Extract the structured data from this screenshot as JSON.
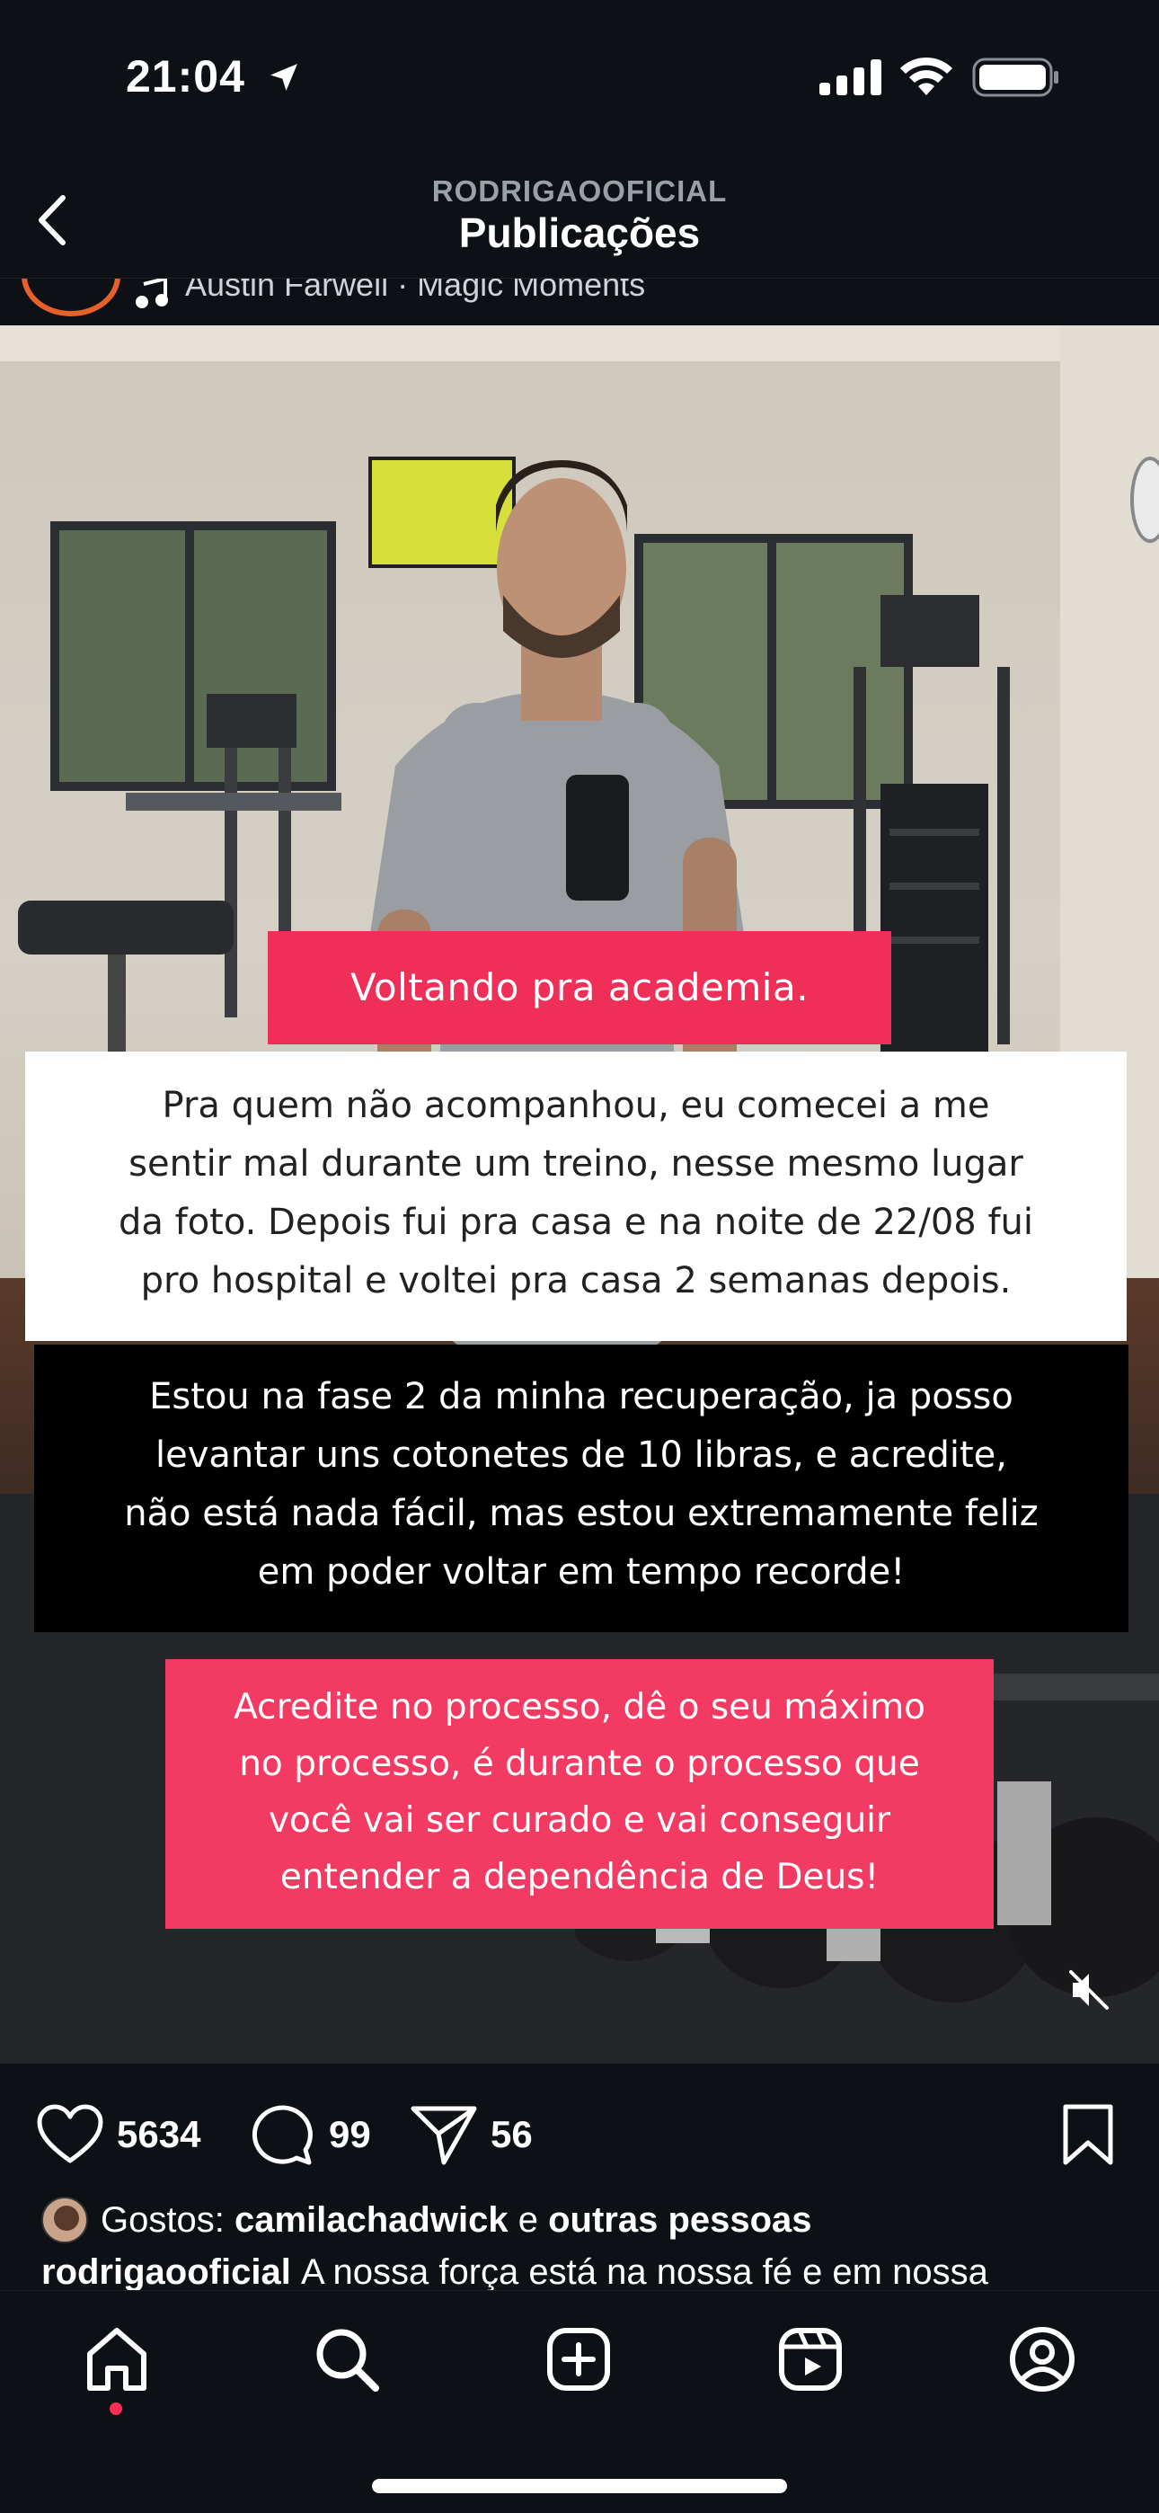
{
  "status_bar": {
    "time": "21:04",
    "icons": [
      "location-arrow-icon",
      "cellular-signal-icon",
      "wifi-icon",
      "battery-icon"
    ]
  },
  "header": {
    "username": "RODRIGAOOFICIAL",
    "title": "Publicações"
  },
  "audio": {
    "text": "Austin Farwell · Magic Moments"
  },
  "post": {
    "overlay_title": "Voltando pra academia.",
    "white_box_lines": [
      "Pra quem não acompanhou, eu comecei a me",
      "sentir mal durante um treino, nesse mesmo lugar",
      "da foto. Depois fui pra casa e na noite de 22/08 fui",
      "pro hospital e voltei pra casa 2 semanas depois."
    ],
    "black_box_lines": [
      "Estou na fase 2 da minha recuperação, ja posso",
      "levantar uns cotonetes de 10 libras, e acredite,",
      "não está nada fácil, mas estou extremamente feliz",
      "em poder voltar em tempo recorde!"
    ],
    "pink_box_lines": [
      "Acredite no processo, dê o seu máximo",
      "no processo, é durante o processo que",
      "você vai ser curado e vai conseguir",
      "entender a dependência de Deus!"
    ]
  },
  "actions": {
    "likes": "5634",
    "comments": "99",
    "shares": "56"
  },
  "likes_line": {
    "prefix": "Gostos:",
    "user": "camilachadwick",
    "conjunction": "e",
    "others": "outras pessoas"
  },
  "caption": {
    "username": "rodrigaooficial",
    "text": "A nossa força está na nossa fé e em nossa"
  },
  "colors": {
    "background": "#0d1015",
    "accent_pink": "#ef2f58",
    "notification_dot": "#ff2d55"
  }
}
